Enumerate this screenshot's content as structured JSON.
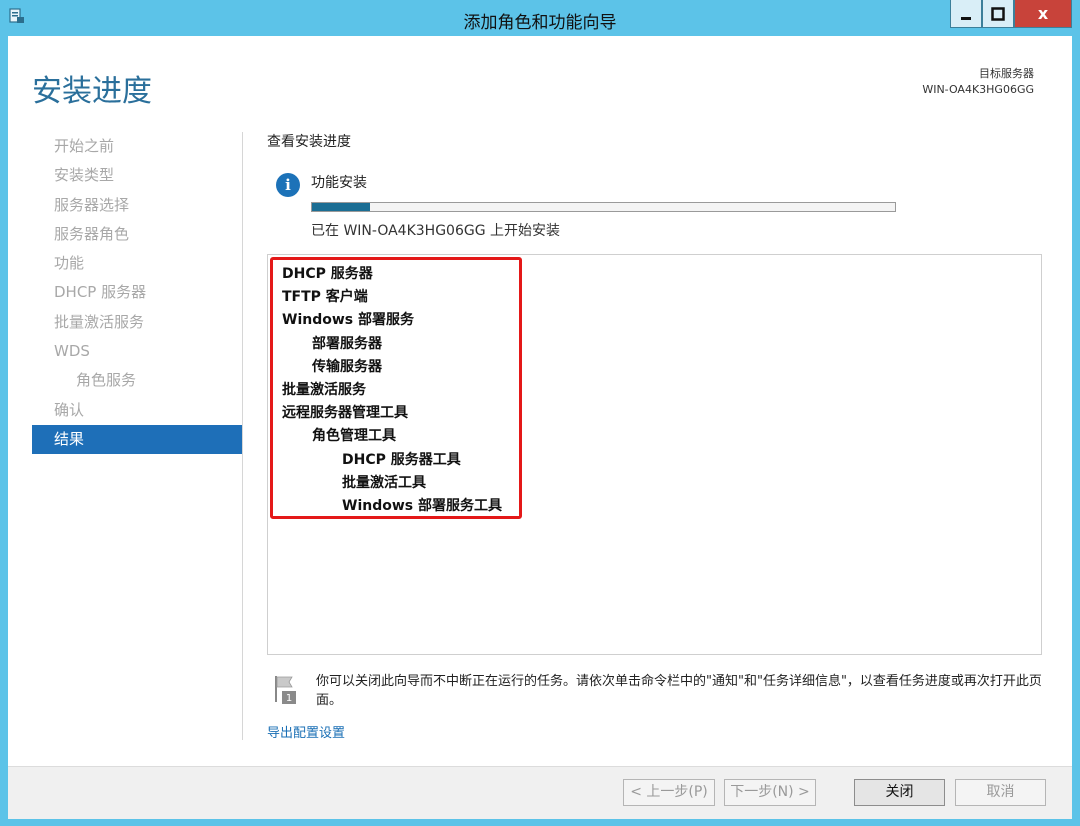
{
  "window": {
    "title": "添加角色和功能向导",
    "close_glyph": "x"
  },
  "header": {
    "page_title": "安装进度",
    "target_label": "目标服务器",
    "target_server": "WIN-OA4K3HG06GG"
  },
  "nav": {
    "items": [
      {
        "label": "开始之前",
        "level": 0,
        "active": false
      },
      {
        "label": "安装类型",
        "level": 0,
        "active": false
      },
      {
        "label": "服务器选择",
        "level": 0,
        "active": false
      },
      {
        "label": "服务器角色",
        "level": 0,
        "active": false
      },
      {
        "label": "功能",
        "level": 0,
        "active": false
      },
      {
        "label": "DHCP 服务器",
        "level": 0,
        "active": false
      },
      {
        "label": "批量激活服务",
        "level": 0,
        "active": false
      },
      {
        "label": "WDS",
        "level": 0,
        "active": false
      },
      {
        "label": "角色服务",
        "level": 1,
        "active": false
      },
      {
        "label": "确认",
        "level": 0,
        "active": false
      },
      {
        "label": "结果",
        "level": 0,
        "active": true
      }
    ]
  },
  "main": {
    "section_label": "查看安装进度",
    "info_glyph": "i",
    "feature_label": "功能安装",
    "progress_fraction": 0.1,
    "status_text": "已在 WIN-OA4K3HG06GG 上开始安装",
    "results": [
      {
        "label": "DHCP 服务器",
        "level": 0
      },
      {
        "label": "TFTP 客户端",
        "level": 0
      },
      {
        "label": "Windows 部署服务",
        "level": 0
      },
      {
        "label": "部署服务器",
        "level": 1
      },
      {
        "label": "传输服务器",
        "level": 1
      },
      {
        "label": "批量激活服务",
        "level": 0
      },
      {
        "label": "远程服务器管理工具",
        "level": 0
      },
      {
        "label": "角色管理工具",
        "level": 1
      },
      {
        "label": "DHCP 服务器工具",
        "level": 2
      },
      {
        "label": "批量激活工具",
        "level": 2
      },
      {
        "label": "Windows 部署服务工具",
        "level": 2
      }
    ],
    "note_badge": "1",
    "note_text": "你可以关闭此向导而不中断正在运行的任务。请依次单击命令栏中的\"通知\"和\"任务详细信息\"，以查看任务进度或再次打开此页面。",
    "export_link": "导出配置设置"
  },
  "footer": {
    "prev_label": "< 上一步(P)",
    "next_label": "下一步(N) >",
    "close_label": "关闭",
    "cancel_label": "取消"
  },
  "colors": {
    "frame": "#5cc3e8",
    "title_text": "#2a6f9b",
    "nav_active": "#1e6fb8",
    "highlight_border": "#e41818",
    "progress_fill": "#1b6e94"
  }
}
